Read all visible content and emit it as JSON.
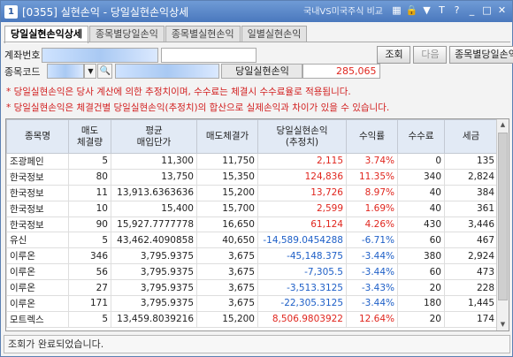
{
  "window": {
    "number": "1",
    "title": "[0355] 실현손익 - 당일실현손익상세",
    "ad_text": "국내VS미국주식 비교",
    "toolbar_icons": [
      "grid-icon",
      "lock-icon",
      "pin-icon",
      "font-size-icon",
      "help-icon",
      "minimize-icon",
      "maximize-icon",
      "close-icon"
    ],
    "toolbar_glyphs": [
      "▦",
      "🔒",
      "▼",
      "T",
      "?",
      "_",
      "□",
      "✕"
    ]
  },
  "tabs": [
    "당일실현손익상세",
    "종목별당일손익",
    "종목별실현손익",
    "일별실현손익"
  ],
  "account": {
    "label": "계좌번호",
    "value": "",
    "buttons": {
      "search": "조회",
      "next": "다음",
      "by_item": "종목별당일손익"
    }
  },
  "stock": {
    "label": "종목코드",
    "value": "",
    "summary_label": "당일실현손익",
    "summary_value": "285,065"
  },
  "notes": [
    "* 당일실현손익은 당사 계산에 의한 추정치이며, 수수료는 체결시 수수료율로 적용됩니다.",
    "* 당일실현손익은 체결건별 당일실현손익(추정치)의 합산으로 실제손익과 차이가 있을 수 있습니다."
  ],
  "table": {
    "headers": [
      "종목명",
      "매도\n체결량",
      "평균\n매입단가",
      "매도체결가",
      "당일실현손익\n(추정치)",
      "수익률",
      "수수료",
      "세금"
    ],
    "rows": [
      [
        "조광페인",
        "5",
        "11,300",
        "11,750",
        "2,115",
        "3.74%",
        "0",
        "135"
      ],
      [
        "한국정보",
        "80",
        "13,750",
        "15,350",
        "124,836",
        "11.35%",
        "340",
        "2,824"
      ],
      [
        "한국정보",
        "11",
        "13,913.6363636",
        "15,200",
        "13,726",
        "8.97%",
        "40",
        "384"
      ],
      [
        "한국정보",
        "10",
        "15,400",
        "15,700",
        "2,599",
        "1.69%",
        "40",
        "361"
      ],
      [
        "한국정보",
        "90",
        "15,927.7777778",
        "16,650",
        "61,124",
        "4.26%",
        "430",
        "3,446"
      ],
      [
        "유신",
        "5",
        "43,462.4090858",
        "40,650",
        "-14,589.0454288",
        "-6.71%",
        "60",
        "467"
      ],
      [
        "이루온",
        "346",
        "3,795.9375",
        "3,675",
        "-45,148.375",
        "-3.44%",
        "380",
        "2,924"
      ],
      [
        "이루온",
        "56",
        "3,795.9375",
        "3,675",
        "-7,305.5",
        "-3.44%",
        "60",
        "473"
      ],
      [
        "이루온",
        "27",
        "3,795.9375",
        "3,675",
        "-3,513.3125",
        "-3.43%",
        "20",
        "228"
      ],
      [
        "이루온",
        "171",
        "3,795.9375",
        "3,675",
        "-22,305.3125",
        "-3.44%",
        "180",
        "1,445"
      ],
      [
        "모트렉스",
        "5",
        "13,459.8039216",
        "15,200",
        "8,506.9803922",
        "12.64%",
        "20",
        "174"
      ]
    ],
    "colors": {
      "positive": "#e0271f",
      "negative": "#1e5fc7"
    }
  },
  "status_text": "조회가 완료되었습니다."
}
